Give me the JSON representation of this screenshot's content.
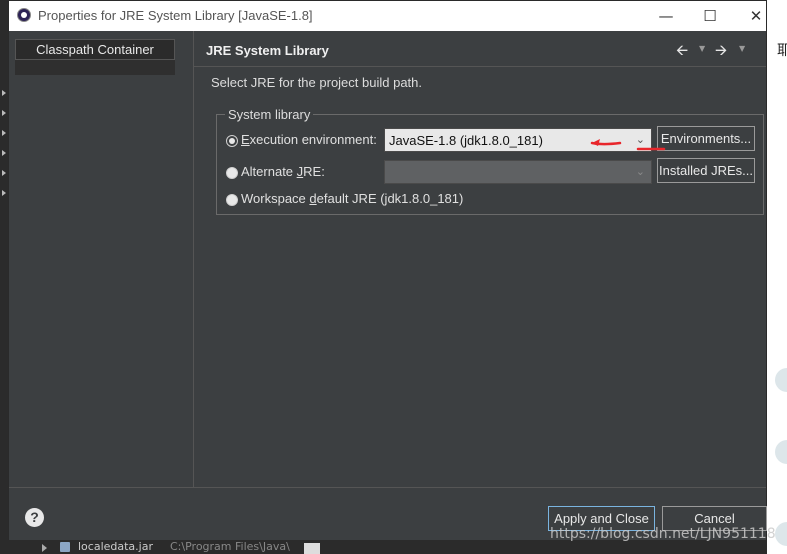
{
  "window": {
    "title": "Properties for JRE System Library [JavaSE-1.8]",
    "minimize_glyph": "—",
    "maximize_glyph": "☐",
    "close_glyph": "✕"
  },
  "left_pane": {
    "items": [
      "Classpath Container"
    ]
  },
  "page": {
    "title": "JRE System Library",
    "description": "Select JRE for the project build path.",
    "nav": {
      "back_glyph": "🡨",
      "forward_glyph": "🡪",
      "dropdown_glyph": "▼"
    }
  },
  "system_library": {
    "group_label": "System library",
    "execution_environment": {
      "label_prefix": "E",
      "label_rest": "xecution environment:",
      "selected": true,
      "combo_value": "JavaSE-1.8 (jdk1.8.0_181)",
      "button_label": "Environments..."
    },
    "alternate_jre": {
      "label_prefix": "Alternate ",
      "label_mnemonic": "J",
      "label_rest": "RE:",
      "selected": false,
      "combo_value": "",
      "button_label": "Installed JREs..."
    },
    "workspace_default": {
      "label_prefix": "Workspace ",
      "label_mnemonic": "d",
      "label_rest": "efault JRE (jdk1.8.0_181)",
      "selected": false
    }
  },
  "footer": {
    "help_glyph": "?",
    "apply_close_label": "Apply and Close",
    "cancel_label": "Cancel"
  },
  "background": {
    "right_char": "耶",
    "bottom_file_name": "localedata.jar",
    "bottom_file_path": "C:\\Program Files\\Java\\"
  },
  "watermark": "https://blog.csdn.net/LJN951118",
  "colors": {
    "dialog_bg": "#3c3f41",
    "annotation_red": "#e8262b",
    "primary_button_border": "#7ab4e0"
  }
}
